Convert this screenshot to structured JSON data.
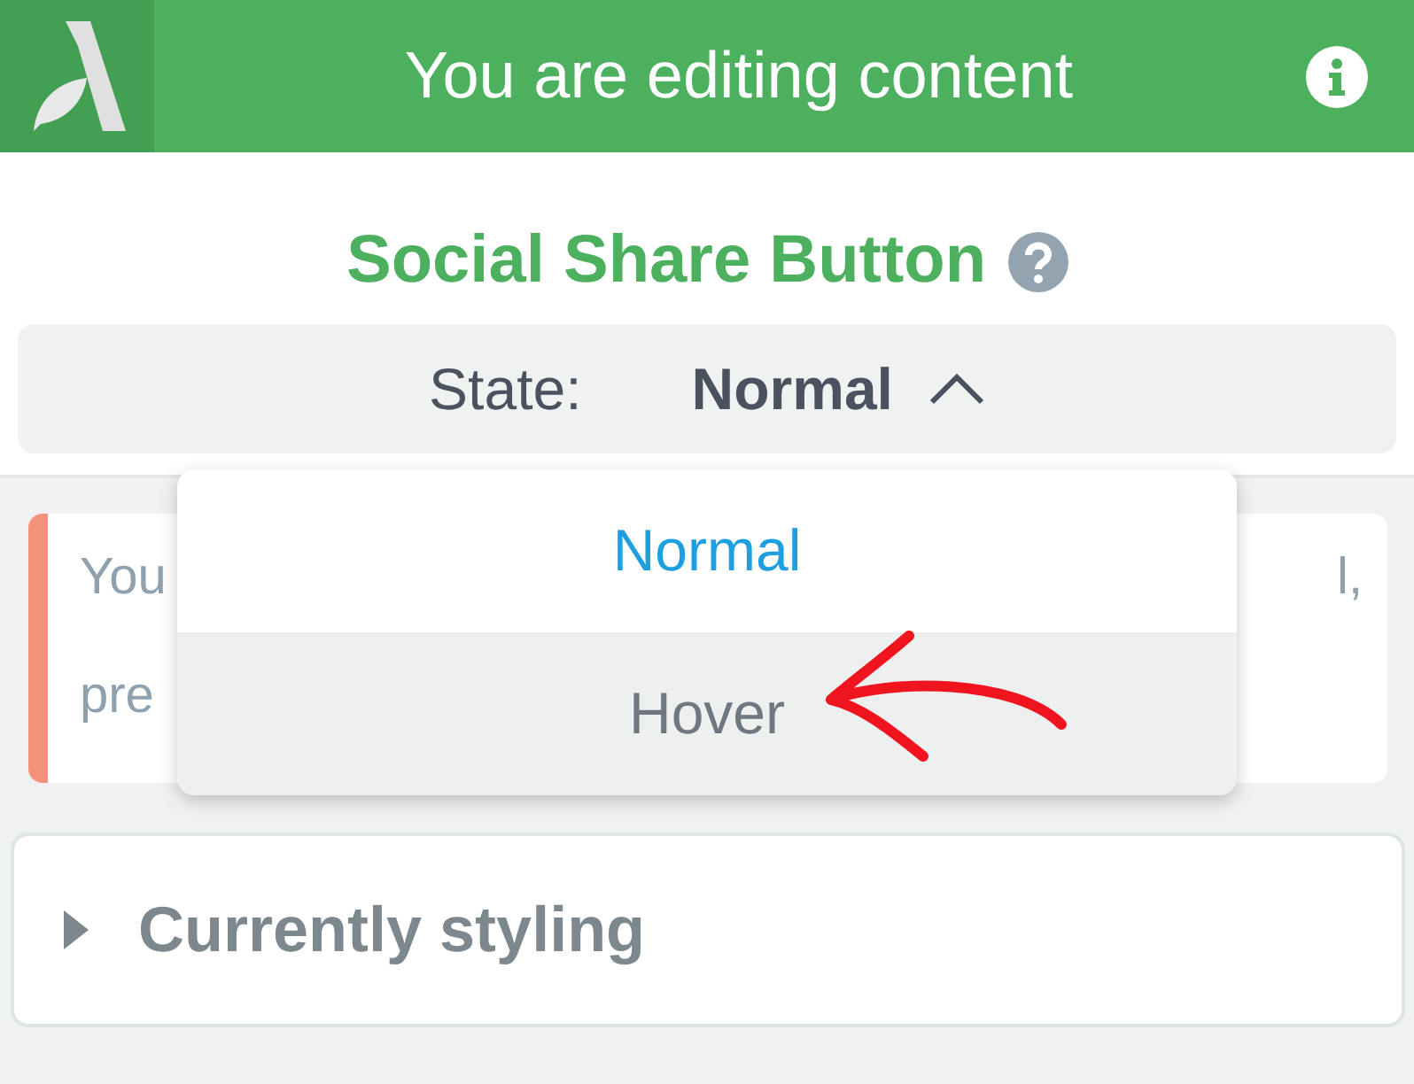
{
  "header": {
    "title": "You are editing content"
  },
  "panel_title": "Social Share Button",
  "state_selector": {
    "label": "State:",
    "value": "Normal",
    "expanded": true
  },
  "dropdown": [
    {
      "label": "Normal",
      "selected": true,
      "hovered": false
    },
    {
      "label": "Hover",
      "selected": false,
      "hovered": true
    }
  ],
  "notice": {
    "line_1_start": "You",
    "line_1_end": "l,",
    "line_2_start": "pre"
  },
  "section": {
    "title": "Currently styling",
    "expanded": false
  }
}
